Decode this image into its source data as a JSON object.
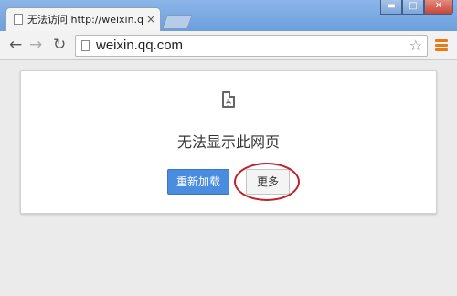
{
  "tab": {
    "title": "无法访问 http://weixin.q",
    "close": "×"
  },
  "window_controls": {
    "minimize": "▬",
    "maximize": "□",
    "close": "✕"
  },
  "toolbar": {
    "back": "←",
    "forward": "→",
    "reload": "↻",
    "star": "☆"
  },
  "address_bar": {
    "url": "weixin.qq.com"
  },
  "error": {
    "eyes": "• •",
    "title": "无法显示此网页",
    "reload_label": "重新加载",
    "more_label": "更多"
  }
}
